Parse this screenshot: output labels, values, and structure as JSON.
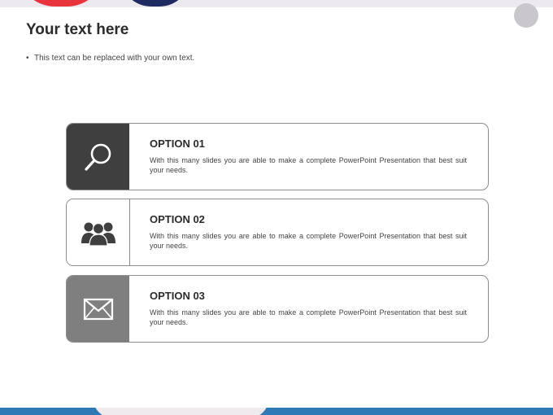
{
  "slide": {
    "title": "Your text here",
    "bullet": "This text can be replaced with your own text."
  },
  "options": [
    {
      "heading": "OPTION 01",
      "text": "With this many slides you are able to make a complete PowerPoint Presentation that best suit your needs.",
      "icon": "magnifier-icon"
    },
    {
      "heading": "OPTION 02",
      "text": "With this many slides you are able to make a complete PowerPoint Presentation that best suit your needs.",
      "icon": "group-icon"
    },
    {
      "heading": "OPTION 03",
      "text": "With this many slides you are able to make a complete PowerPoint Presentation that best suit your needs.",
      "icon": "envelope-icon"
    }
  ],
  "colors": {
    "accent_red": "#e8333d",
    "accent_navy": "#1f2b63",
    "accent_blue": "#2f79b4",
    "icon_dark": "#3f3f3f",
    "icon_mid": "#7f7f7f"
  }
}
